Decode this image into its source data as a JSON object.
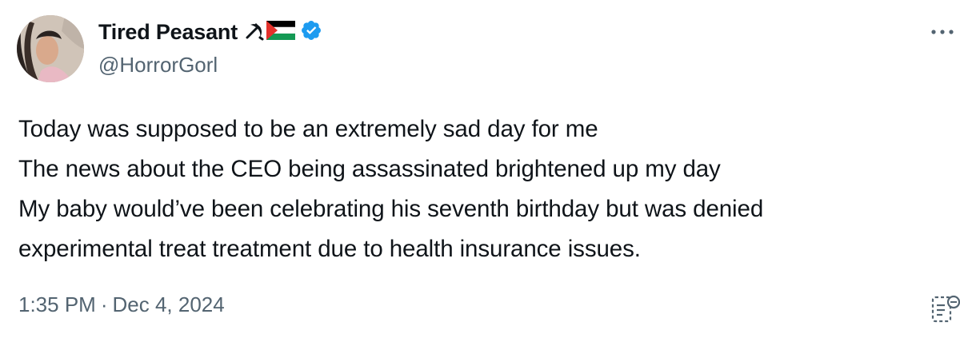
{
  "author": {
    "display_name": "Tired Peasant",
    "handle": "@HorrorGorl",
    "name_emojis": [
      "hammer-and-sickle-icon",
      "palestine-flag-icon"
    ],
    "verified": true
  },
  "tweet": {
    "lines": [
      "Today was supposed to be an extremely sad day for me",
      "The news about the CEO being assassinated brightened up my day",
      "My baby would’ve been celebrating his seventh birthday but was denied",
      "experimental treat treatment due to health insurance issues."
    ],
    "time": "1:35 PM",
    "separator": "·",
    "date": "Dec 4, 2024"
  },
  "colors": {
    "text": "#0f1419",
    "secondary": "#536471",
    "verified": "#1d9bf0"
  }
}
